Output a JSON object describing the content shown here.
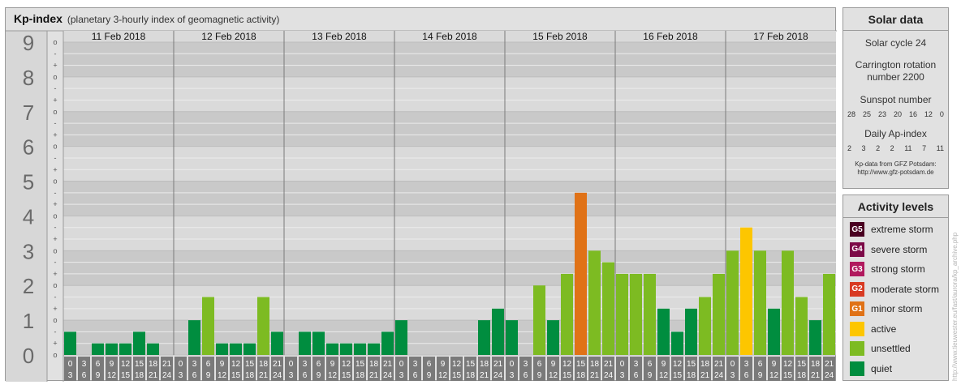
{
  "title": {
    "main": "Kp-index",
    "subtitle": "(planetary 3-hourly index of geomagnetic activity)"
  },
  "chart_data": {
    "type": "bar",
    "title": "Kp-index",
    "subtitle": "(planetary 3-hourly index of geomagnetic activity)",
    "ylim": [
      0,
      9
    ],
    "y_ticks": [
      "0",
      "1",
      "2",
      "3",
      "4",
      "5",
      "6",
      "7",
      "8",
      "9"
    ],
    "minor_marks": [
      "o",
      "+",
      "-"
    ],
    "days": [
      "11 Feb 2018",
      "12 Feb 2018",
      "13 Feb 2018",
      "14 Feb 2018",
      "15 Feb 2018",
      "16 Feb 2018",
      "17 Feb 2018"
    ],
    "hour_start": [
      "0",
      "3",
      "6",
      "9",
      "12",
      "15",
      "18",
      "21"
    ],
    "hour_end": [
      "3",
      "6",
      "9",
      "12",
      "15",
      "18",
      "21",
      "24"
    ],
    "values": [
      0.667,
      0,
      0.333,
      0.333,
      0.333,
      0.667,
      0.333,
      0,
      0,
      1,
      1.667,
      0.333,
      0.333,
      0.333,
      1.667,
      0.667,
      0,
      0.667,
      0.667,
      0.333,
      0.333,
      0.333,
      0.333,
      0.667,
      1,
      0,
      0,
      0,
      0,
      0,
      1,
      1.333,
      1,
      0,
      2,
      1,
      2.333,
      4.667,
      3,
      2.667,
      2.333,
      2.333,
      2.333,
      1.333,
      0.667,
      1.333,
      1.667,
      2.333,
      3,
      3.667,
      3,
      1.333,
      3,
      1.667,
      1,
      2.333
    ],
    "colors": {
      "quiet": "#008d3f",
      "unsettled": "#7dbb22",
      "active": "#fdc600",
      "minor_storm": "#e07217",
      "moderate_storm": "#d83a22",
      "strong_storm": "#b1195e",
      "severe_storm": "#7c0a47",
      "extreme_storm": "#4a0021"
    },
    "grid": true,
    "legend": "right"
  },
  "solar": {
    "heading": "Solar data",
    "cycle": "Solar cycle 24",
    "carrington_1": "Carrington rotation",
    "carrington_2": "number 2200",
    "sunspot_label": "Sunspot number",
    "sunspot_values": [
      "28",
      "25",
      "23",
      "20",
      "16",
      "12",
      "0"
    ],
    "ap_label": "Daily Ap-index",
    "ap_values": [
      "2",
      "3",
      "2",
      "2",
      "11",
      "7",
      "11"
    ],
    "credit_1": "Kp-data from GFZ Potsdam:",
    "credit_2": "http://www.gfz-potsdam.de"
  },
  "activity": {
    "heading": "Activity levels",
    "levels": [
      {
        "code": "G5",
        "label": "extreme storm",
        "color": "#4a0021"
      },
      {
        "code": "G4",
        "label": "severe storm",
        "color": "#7c0a47"
      },
      {
        "code": "G3",
        "label": "strong storm",
        "color": "#b1195e"
      },
      {
        "code": "G2",
        "label": "moderate storm",
        "color": "#d83a22"
      },
      {
        "code": "G1",
        "label": "minor storm",
        "color": "#e07217"
      },
      {
        "code": "",
        "label": "active",
        "color": "#fdc600"
      },
      {
        "code": "",
        "label": "unsettled",
        "color": "#7dbb22"
      },
      {
        "code": "",
        "label": "quiet",
        "color": "#008d3f"
      }
    ]
  },
  "side_url": "http://www.tieuwester.eu/fast/aurora/kp_archive.php"
}
